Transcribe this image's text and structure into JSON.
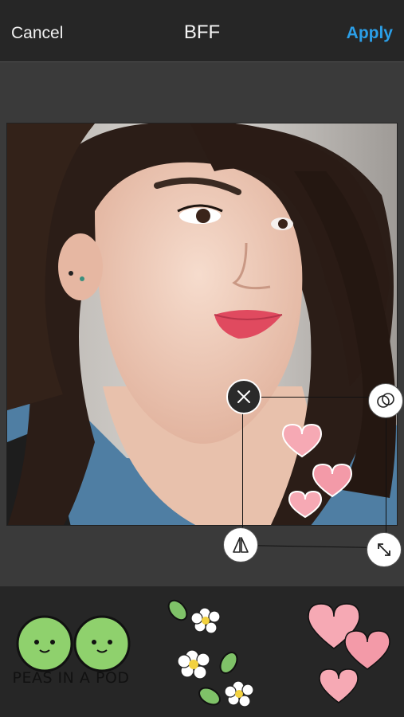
{
  "header": {
    "cancel_label": "Cancel",
    "title": "BFF",
    "apply_label": "Apply"
  },
  "icons": {
    "delete": "close-icon",
    "layer": "overlapping-circles-icon",
    "flip": "flip-icon",
    "resize": "resize-arrows-icon"
  },
  "colors": {
    "topbar_bg": "#262626",
    "canvas_bg": "#3a3a3a",
    "tray_bg": "#262626",
    "apply_accent": "#2b9fe8",
    "heart_pink": "#f6a9b4",
    "pea_green": "#8fd16d"
  },
  "sticker_tray": {
    "items": [
      {
        "name": "peas-in-a-pod",
        "caption": "PEAS IN A POD"
      },
      {
        "name": "flowers-and-leaves"
      },
      {
        "name": "pink-hearts"
      }
    ]
  }
}
